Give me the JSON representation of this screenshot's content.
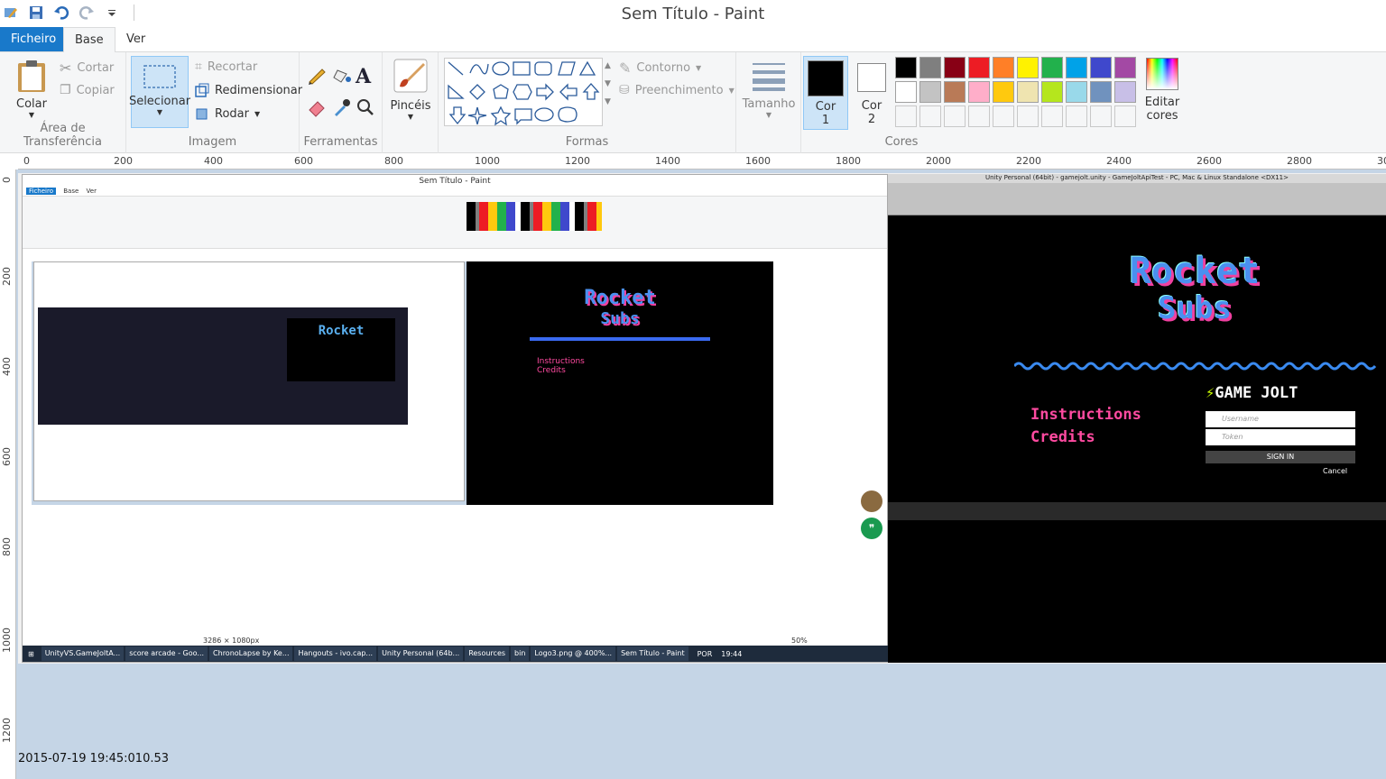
{
  "window": {
    "title": "Sem Título - Paint"
  },
  "tabs": [
    {
      "label": "Ficheiro"
    },
    {
      "label": "Base"
    },
    {
      "label": "Ver"
    }
  ],
  "clipboard": {
    "paste_label": "Colar",
    "cut_label": "Cortar",
    "copy_label": "Copiar",
    "group_label": "Área de Transferência"
  },
  "image": {
    "select_label": "Selecionar",
    "crop_label": "Recortar",
    "resize_label": "Redimensionar",
    "rotate_label": "Rodar",
    "group_label": "Imagem"
  },
  "tools": {
    "group_label": "Ferramentas"
  },
  "brushes": {
    "label": "Pincéis"
  },
  "shapes": {
    "outline_label": "Contorno",
    "fill_label": "Preenchimento",
    "group_label": "Formas"
  },
  "size": {
    "label": "Tamanho"
  },
  "colors": {
    "color1_label": "Cor",
    "color1_num": "1",
    "color2_label": "Cor",
    "color2_num": "2",
    "edit_label": "Editar",
    "edit_label2": "cores",
    "group_label": "Cores",
    "color1": "#000000",
    "color2": "#ffffff",
    "palette": [
      "#000000",
      "#7f7f7f",
      "#880015",
      "#ed1c24",
      "#ff7f27",
      "#fff200",
      "#22b14c",
      "#00a2e8",
      "#3f48cc",
      "#a349a4",
      "#ffffff",
      "#c3c3c3",
      "#b97a57",
      "#ffaec9",
      "#ffc90e",
      "#efe4b0",
      "#b5e61d",
      "#99d9ea",
      "#7092be",
      "#c8bfe7"
    ]
  },
  "ruler": {
    "h_ticks": [
      "0",
      "200",
      "400",
      "600",
      "800",
      "1000",
      "1200",
      "1400",
      "1600",
      "1800",
      "2000",
      "2200",
      "2400",
      "2600",
      "2800",
      "30"
    ],
    "v_ticks": [
      "0",
      "200",
      "400",
      "600",
      "800",
      "1000",
      "1200"
    ]
  },
  "canvas_content": {
    "inner_title": "Sem Título - Paint",
    "unity_title": "Unity Personal (64bit) - gamejolt.unity - GameJoltApiTest - PC, Mac & Linux Standalone <DX11>",
    "game_title_1": "Rocket",
    "game_title_2": "Subs",
    "instructions": "Instructions",
    "credits": "Credits",
    "gamejolt": "GAME JOLT",
    "username_ph": "Username",
    "token_ph": "Token",
    "sign_in": "SIGN IN",
    "cancel": "Cancel",
    "size_readout": "3286 × 1080px",
    "zoom": "50%",
    "taskbar_items": [
      "UnityVS.GameJoltA...",
      "score arcade - Goo...",
      "ChronoLapse by Ke...",
      "Hangouts - ivo.cap...",
      "Unity Personal (64b...",
      "Resources",
      "bin",
      "Logo3.png @ 400%...",
      "Sem Título - Paint"
    ],
    "lang": "POR",
    "clock": "19:44"
  },
  "timestamp": "2015-07-19 19:45:010.53"
}
